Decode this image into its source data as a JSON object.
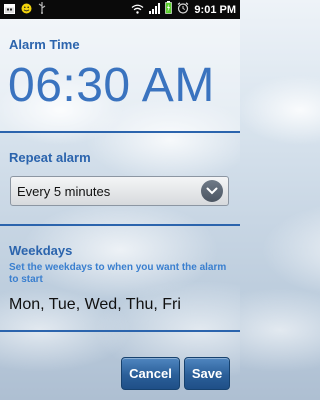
{
  "status_bar": {
    "time": "9:01 PM",
    "left_icons": [
      "calendar-icon",
      "smiley-icon",
      "usb-icon"
    ],
    "right_icons": [
      "wifi-icon",
      "signal-icon",
      "battery-charging-icon",
      "alarm-clock-icon"
    ]
  },
  "alarm": {
    "title": "Alarm Time",
    "time": "06:30 AM"
  },
  "repeat": {
    "title": "Repeat alarm",
    "selected": "Every 5 minutes"
  },
  "weekdays": {
    "title": "Weekdays",
    "hint": "Set the weekdays to when you want the alarm to start",
    "value": "Mon, Tue, Wed, Thu, Fri"
  },
  "actions": {
    "cancel_label": "Cancel",
    "save_label": "Save"
  },
  "colors": {
    "accent": "#2b64ad",
    "time_text": "#3a73bf",
    "hint_text": "#3a7fcf",
    "button": "#2b5f99"
  }
}
